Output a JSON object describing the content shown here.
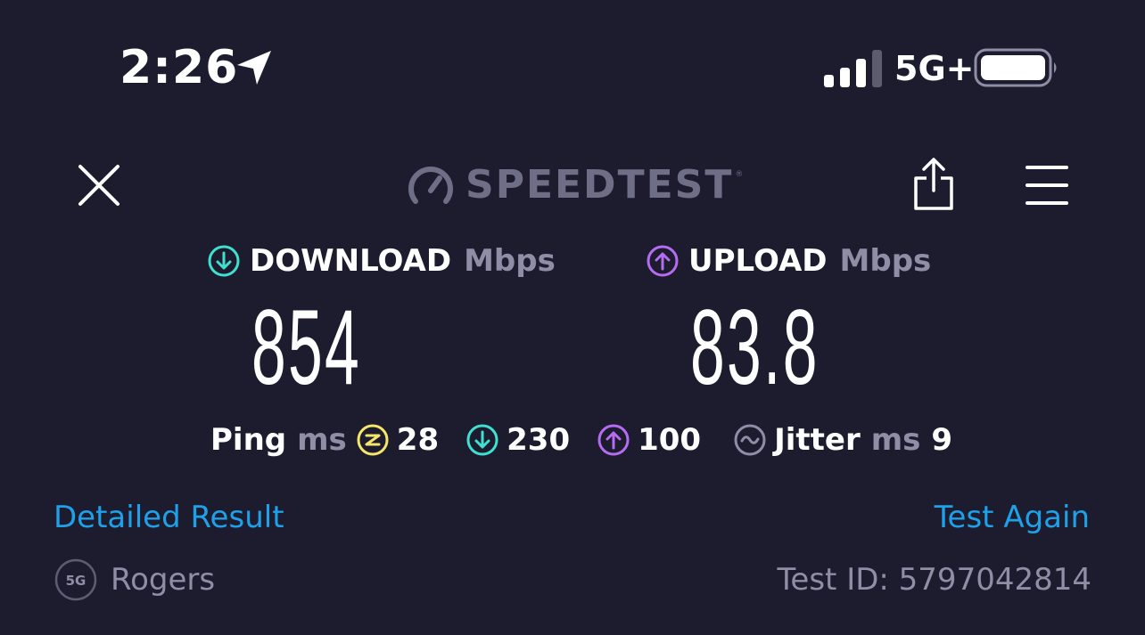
{
  "status_bar": {
    "time": "2:26",
    "network": "5G+"
  },
  "header": {
    "logo_text": "SPEEDTEST",
    "logo_tm": "®"
  },
  "download": {
    "label": "DOWNLOAD",
    "unit": "Mbps",
    "value": "854",
    "color": "#3fe0d0"
  },
  "upload": {
    "label": "UPLOAD",
    "unit": "Mbps",
    "value": "83.8",
    "color": "#b66cf2"
  },
  "ping": {
    "label": "Ping",
    "unit": "ms",
    "idle": "28",
    "download": "230",
    "upload": "100",
    "idle_color": "#f5e56b"
  },
  "jitter": {
    "label": "Jitter",
    "unit": "ms",
    "value": "9"
  },
  "links": {
    "detailed": "Detailed Result",
    "again": "Test Again"
  },
  "footer": {
    "network_badge": "5G",
    "provider": "Rogers",
    "test_id": "Test ID: 5797042814"
  },
  "colors": {
    "background": "#1c1c2e",
    "link": "#1fa0e8",
    "muted": "#8e8ea6"
  }
}
